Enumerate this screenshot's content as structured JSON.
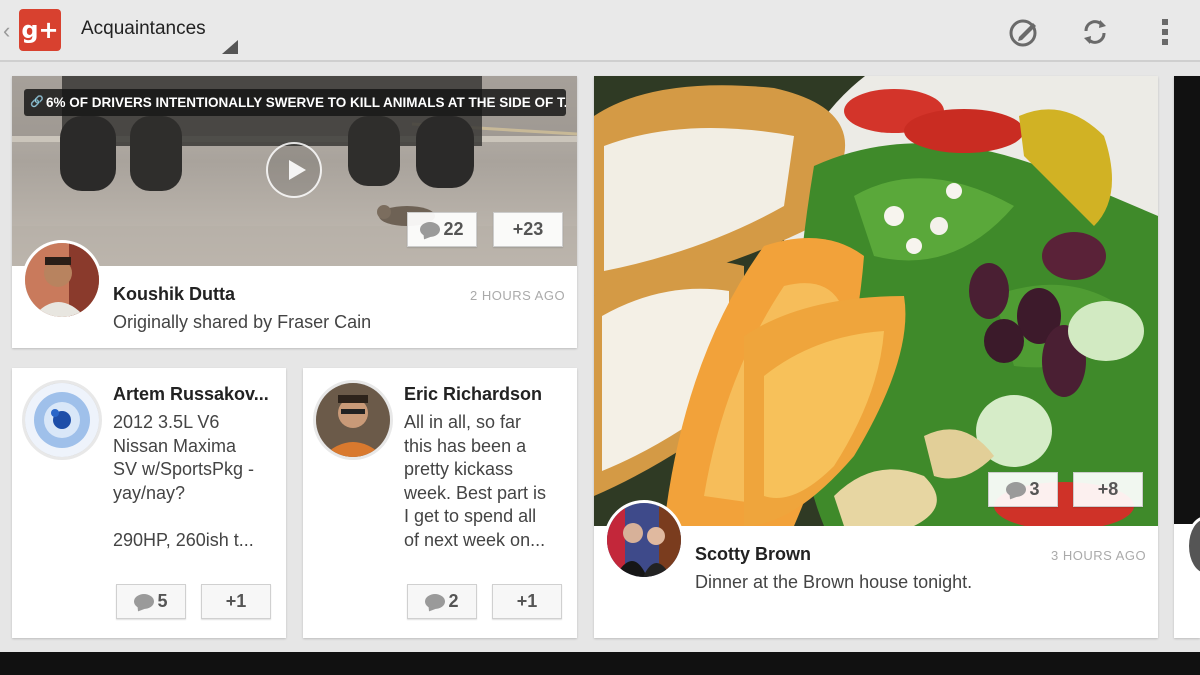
{
  "header": {
    "back_glyph": "‹",
    "logo_text": "g+",
    "title": "Acquaintances",
    "actions": [
      "compose-icon",
      "refresh-icon",
      "overflow-menu-icon"
    ]
  },
  "cards": {
    "video_post": {
      "link_title": "6% OF DRIVERS INTENTIONALLY SWERVE TO KILL ANIMALS AT THE SIDE OF T...",
      "author": "Koushik Dutta",
      "time": "2 HOURS AGO",
      "subtext": "Originally shared by Fraser Cain",
      "comments": "22",
      "plus": "+23"
    },
    "artem_post": {
      "author": "Artem Russakov...",
      "body": "2012 3.5L V6\nNissan Maxima\nSV w/SportsPkg -\nyay/nay?\n\n290HP, 260ish t...",
      "comments": "5",
      "plus": "+1"
    },
    "eric_post": {
      "author": "Eric Richardson",
      "body": "All in all, so far\nthis has been a\npretty kickass\nweek. Best part is\nI get to spend all\nof next week on...",
      "comments": "2",
      "plus": "+1"
    },
    "photo_post": {
      "author": "Scotty Brown",
      "time": "3 HOURS AGO",
      "subtext": "Dinner at the Brown house tonight.",
      "comments": "3",
      "plus": "+8"
    }
  },
  "colors": {
    "brand": "#d8412f",
    "background": "#e6e6e6",
    "card": "#ffffff"
  }
}
